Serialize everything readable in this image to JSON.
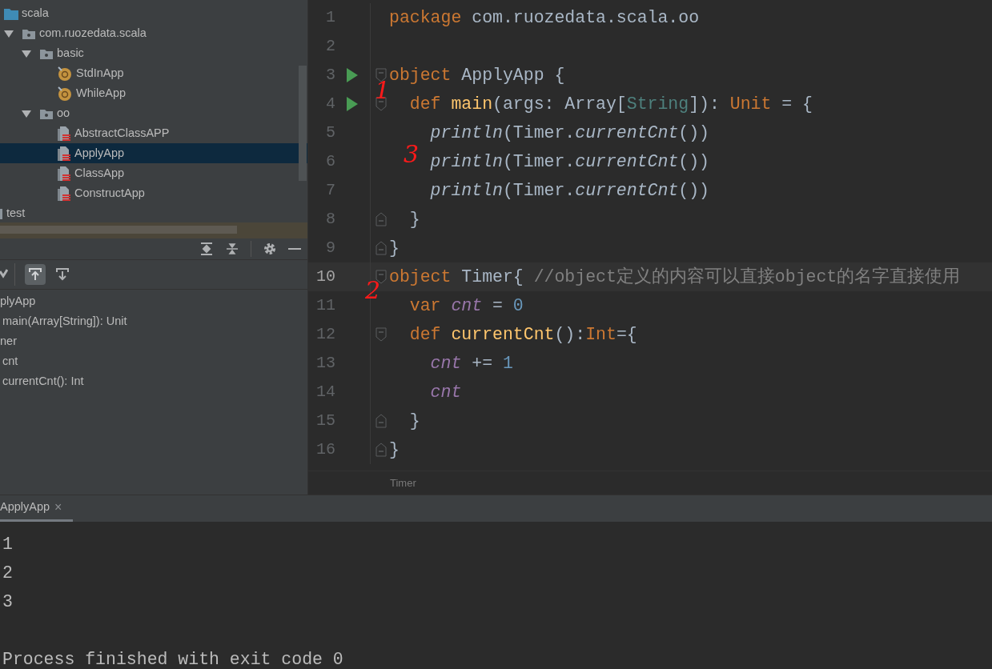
{
  "project_tree": [
    {
      "label": "scala",
      "kind": "source-folder",
      "selected": false,
      "children": [
        {
          "label": "com.ruozedata.scala",
          "kind": "package",
          "expanded": true,
          "selected": false,
          "children": [
            {
              "label": "basic",
              "kind": "package",
              "expanded": true,
              "selected": false,
              "children": [
                {
                  "label": "StdInApp",
                  "kind": "object",
                  "selected": false
                },
                {
                  "label": "WhileApp",
                  "kind": "object",
                  "selected": false
                }
              ]
            },
            {
              "label": "oo",
              "kind": "package",
              "expanded": true,
              "selected": false,
              "children": [
                {
                  "label": "AbstractClassAPP",
                  "kind": "scala-file",
                  "selected": false
                },
                {
                  "label": "ApplyApp",
                  "kind": "scala-file",
                  "selected": true
                },
                {
                  "label": "ClassApp",
                  "kind": "scala-file",
                  "selected": false
                },
                {
                  "label": "ConstructApp",
                  "kind": "scala-file",
                  "selected": false
                }
              ]
            }
          ]
        }
      ]
    },
    {
      "label": "test",
      "kind": "cut-folder",
      "selected": false
    }
  ],
  "structure_toolbar": [
    {
      "kind": "autoscroll-from",
      "selected": true
    },
    {
      "kind": "autoscroll-to",
      "selected": false
    }
  ],
  "structure": [
    {
      "label": "plyApp",
      "children": [
        {
          "label": "main(Array[String]): Unit"
        }
      ]
    },
    {
      "label": "ner",
      "children": [
        {
          "label": "cnt"
        },
        {
          "label": "currentCnt(): Int"
        }
      ]
    }
  ],
  "editor": {
    "lines": [
      {
        "number": "1",
        "run": false,
        "current": false,
        "tokens": [
          {
            "kind": "kw",
            "t": "package"
          },
          {
            "kind": "plain",
            "t": " com.ruozedata.scala.oo"
          }
        ]
      },
      {
        "number": "2",
        "run": false,
        "current": false
      },
      {
        "number": "3",
        "run": true,
        "fold": {
          "kind": "open"
        },
        "current": false,
        "tokens": [
          {
            "kind": "kw",
            "t": "object"
          },
          {
            "kind": "plain",
            "t": " ApplyApp {"
          }
        ]
      },
      {
        "number": "4",
        "run": true,
        "fold": {
          "kind": "open"
        },
        "current": false,
        "mark": "1",
        "tokens": [
          {
            "kind": "kw",
            "t": "  def "
          },
          {
            "kind": "decl",
            "t": "main"
          },
          {
            "kind": "plain",
            "t": "(args: Array["
          },
          {
            "kind": "type",
            "t": "String"
          },
          {
            "kind": "plain",
            "t": "]): "
          },
          {
            "kind": "kw",
            "t": "Unit"
          },
          {
            "kind": "plain",
            "t": " = {"
          }
        ]
      },
      {
        "number": "5",
        "run": false,
        "current": false,
        "tokens": [
          {
            "kind": "italic",
            "t": "    println"
          },
          {
            "kind": "plain",
            "t": "(Timer."
          },
          {
            "kind": "italic",
            "t": "currentCnt"
          },
          {
            "kind": "plain",
            "t": "())"
          }
        ]
      },
      {
        "number": "6",
        "run": false,
        "current": false,
        "mark": "3",
        "tokens": [
          {
            "kind": "italic",
            "t": "    println"
          },
          {
            "kind": "plain",
            "t": "(Timer."
          },
          {
            "kind": "italic",
            "t": "currentCnt"
          },
          {
            "kind": "plain",
            "t": "())"
          }
        ]
      },
      {
        "number": "7",
        "run": false,
        "current": false,
        "tokens": [
          {
            "kind": "italic",
            "t": "    println"
          },
          {
            "kind": "plain",
            "t": "(Timer."
          },
          {
            "kind": "italic",
            "t": "currentCnt"
          },
          {
            "kind": "plain",
            "t": "())"
          }
        ]
      },
      {
        "number": "8",
        "run": false,
        "fold": {
          "kind": "close"
        },
        "current": false,
        "tokens": [
          {
            "kind": "plain",
            "t": "  }"
          }
        ]
      },
      {
        "number": "9",
        "run": false,
        "fold": {
          "kind": "close"
        },
        "current": false,
        "tokens": [
          {
            "kind": "plain",
            "t": "}"
          }
        ]
      },
      {
        "number": "10",
        "run": false,
        "fold": {
          "kind": "open"
        },
        "current": true,
        "tokens": [
          {
            "kind": "kw",
            "t": "object"
          },
          {
            "kind": "plain",
            "t": " Timer{ "
          },
          {
            "kind": "comment",
            "t": "//object定义的内容可以直接object的名字直接使用"
          }
        ]
      },
      {
        "number": "11",
        "run": false,
        "current": false,
        "mark": "2",
        "tokens": [
          {
            "kind": "kw",
            "t": "  var "
          },
          {
            "kind": "field",
            "t": "cnt"
          },
          {
            "kind": "plain",
            "t": " = "
          },
          {
            "kind": "num",
            "t": "0"
          }
        ]
      },
      {
        "number": "12",
        "run": false,
        "fold": {
          "kind": "open"
        },
        "current": false,
        "tokens": [
          {
            "kind": "kw",
            "t": "  def "
          },
          {
            "kind": "decl",
            "t": "currentCnt"
          },
          {
            "kind": "plain",
            "t": "():"
          },
          {
            "kind": "kw",
            "t": "Int"
          },
          {
            "kind": "plain",
            "t": "={"
          }
        ]
      },
      {
        "number": "13",
        "run": false,
        "current": false,
        "tokens": [
          {
            "kind": "field",
            "t": "    cnt"
          },
          {
            "kind": "plain",
            "t": " += "
          },
          {
            "kind": "num",
            "t": "1"
          }
        ]
      },
      {
        "number": "14",
        "run": false,
        "current": false,
        "tokens": [
          {
            "kind": "field",
            "t": "    cnt"
          }
        ]
      },
      {
        "number": "15",
        "run": false,
        "fold": {
          "kind": "close"
        },
        "current": false,
        "tokens": [
          {
            "kind": "plain",
            "t": "  }"
          }
        ]
      },
      {
        "number": "16",
        "run": false,
        "fold": {
          "kind": "close"
        },
        "current": false,
        "tokens": [
          {
            "kind": "plain",
            "t": "}"
          }
        ]
      }
    ],
    "breadcrumb": "Timer"
  },
  "run_tab": {
    "label": "ApplyApp",
    "close": "×",
    "selected": true
  },
  "console": [
    {
      "kind": "output",
      "text": "1"
    },
    {
      "kind": "output",
      "text": "2"
    },
    {
      "kind": "output",
      "text": "3"
    },
    {
      "kind": "status",
      "text": "Process finished with exit code 0"
    }
  ]
}
